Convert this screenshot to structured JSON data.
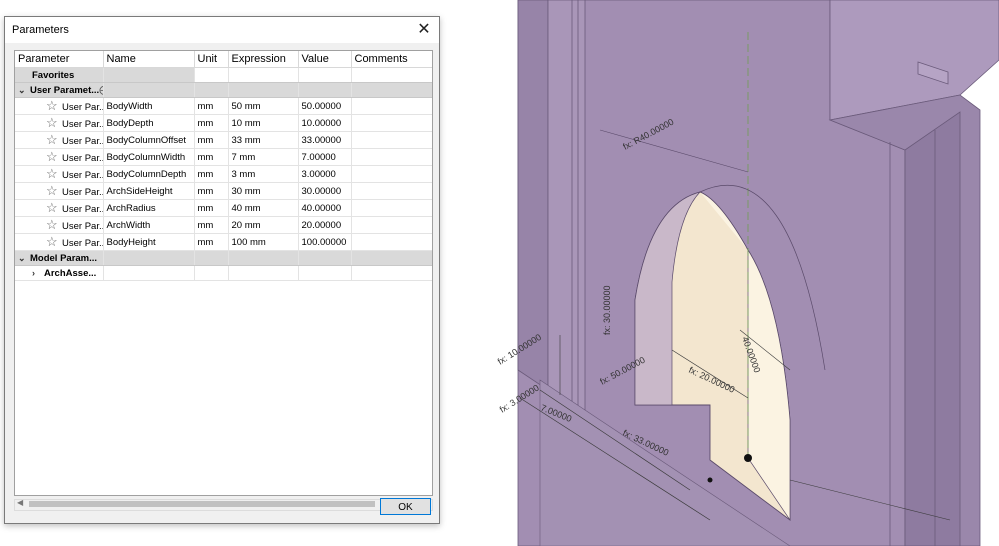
{
  "dialog": {
    "title": "Parameters",
    "close_glyph": "✕",
    "ok_label": "OK"
  },
  "table": {
    "columns": [
      "Parameter",
      "Name",
      "Unit",
      "Expression",
      "Value",
      "Comments"
    ],
    "groups": {
      "favorites": "Favorites",
      "user": "User Paramet...",
      "model": "Model Param...",
      "model_child": "ArchAsse..."
    },
    "rows": [
      {
        "param": "User Par...",
        "name": "BodyWidth",
        "unit": "mm",
        "expr": "50 mm",
        "value": "50.00000"
      },
      {
        "param": "User Par...",
        "name": "BodyDepth",
        "unit": "mm",
        "expr": "10 mm",
        "value": "10.00000"
      },
      {
        "param": "User Par...",
        "name": "BodyColumnOffset",
        "unit": "mm",
        "expr": "33 mm",
        "value": "33.00000"
      },
      {
        "param": "User Par...",
        "name": "BodyColumnWidth",
        "unit": "mm",
        "expr": "7 mm",
        "value": "7.00000"
      },
      {
        "param": "User Par...",
        "name": "BodyColumnDepth",
        "unit": "mm",
        "expr": "3 mm",
        "value": "3.00000"
      },
      {
        "param": "User Par...",
        "name": "ArchSideHeight",
        "unit": "mm",
        "expr": "30 mm",
        "value": "30.00000"
      },
      {
        "param": "User Par...",
        "name": "ArchRadius",
        "unit": "mm",
        "expr": "40 mm",
        "value": "40.00000"
      },
      {
        "param": "User Par...",
        "name": "ArchWidth",
        "unit": "mm",
        "expr": "20 mm",
        "value": "20.00000"
      },
      {
        "param": "User Par...",
        "name": "BodyHeight",
        "unit": "mm",
        "expr": "100 mm",
        "value": "100.00000"
      }
    ]
  },
  "viewport": {
    "dims": {
      "r40": "fx: R40.00000",
      "d30": "fx: 30.00000",
      "d10": "fx: 10.00000",
      "d20": "fx: 20.00000",
      "d40": "40.00000",
      "d50": "fx: 50.00000",
      "d3": "fx: 3.00000",
      "d7": "7.00000",
      "d33": "fx: 33.00000"
    },
    "colors": {
      "body": "#9b86ad",
      "body_dark": "#8a779c",
      "arch_face": "#f5ecd8"
    }
  }
}
